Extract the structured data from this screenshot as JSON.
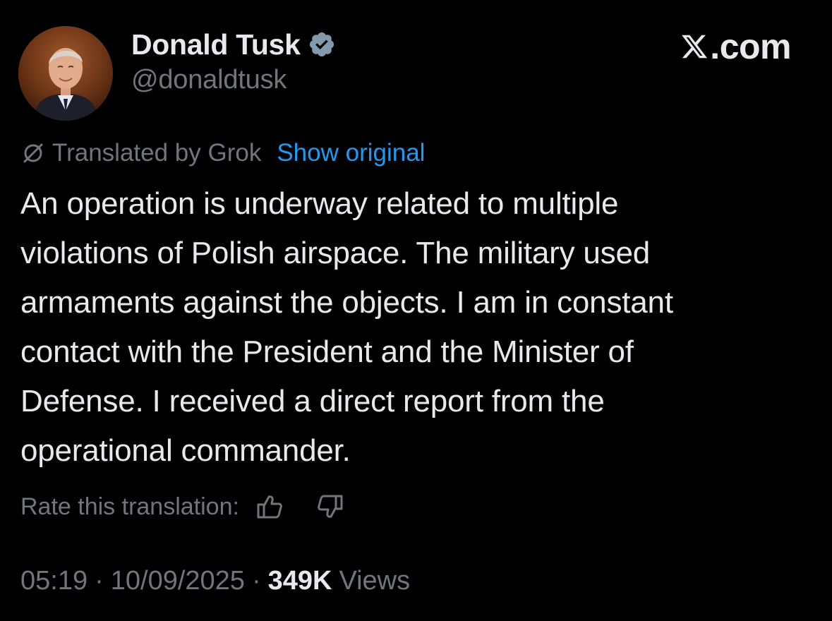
{
  "author": {
    "display_name": "Donald Tusk",
    "handle": "@donaldtusk",
    "verified_icon": "verified-badge-icon",
    "avatar_icon": "profile-photo"
  },
  "brand": {
    "logo_icon": "x-logo-icon",
    "text": ".com"
  },
  "translation": {
    "icon": "translate-icon",
    "translated_by": "Translated by Grok",
    "show_original_label": "Show original"
  },
  "tweet": {
    "lines": [
      "An operation is underway related to multiple",
      "violations of Polish airspace. The military used",
      "armaments against the objects. I am in constant",
      "contact with the President and the Minister of",
      "Defense. I received a direct report from the",
      "operational commander."
    ]
  },
  "rating": {
    "label": "Rate this translation:",
    "thumbs_up_icon": "thumbs-up-icon",
    "thumbs_down_icon": "thumbs-down-icon"
  },
  "meta": {
    "time": "05:19",
    "separator": "·",
    "date": "10/09/2025",
    "views_count": "349K",
    "views_label": "Views"
  },
  "colors": {
    "background": "#000000",
    "text_primary": "#e7e9ea",
    "text_secondary": "#71767b",
    "link": "#1d9bf0",
    "verified": "#829aab"
  }
}
